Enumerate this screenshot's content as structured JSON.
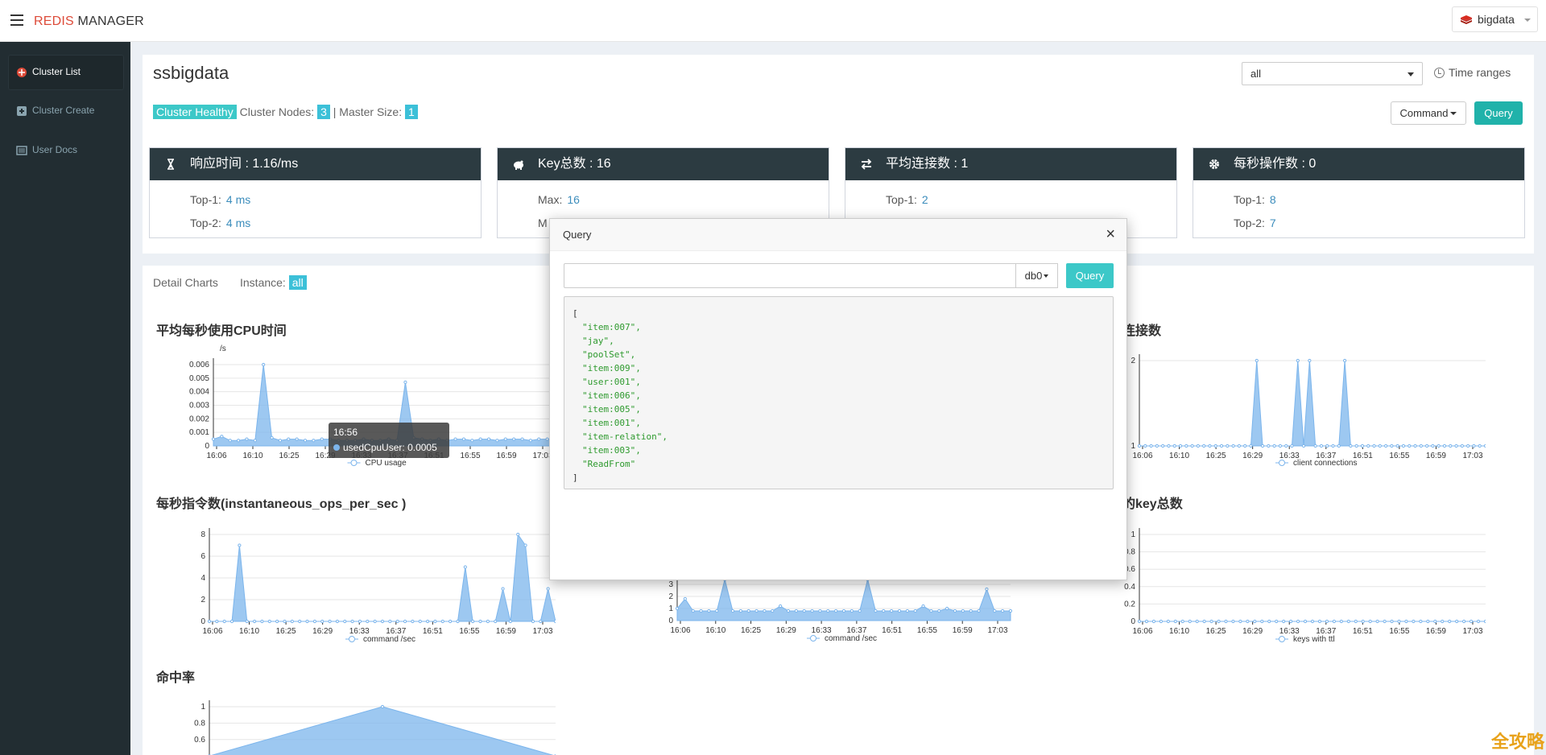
{
  "header": {
    "brand_red": "REDIS",
    "brand_dark": " MANAGER",
    "user": "bigdata"
  },
  "sidebar": {
    "items": [
      {
        "label": "Cluster List"
      },
      {
        "label": "Cluster Create"
      },
      {
        "label": "User Docs"
      }
    ]
  },
  "cluster": {
    "name": "ssbigdata",
    "healthy": "Cluster Healthy",
    "nodes_label": "Cluster Nodes:",
    "nodes": "3",
    "sep": "|",
    "master_label": "Master Size:",
    "master": "1",
    "select_value": "all",
    "time_ranges": "Time ranges",
    "command": "Command",
    "query": "Query"
  },
  "stats": [
    {
      "title": "响应时间 : 1.16/ms",
      "rows": [
        {
          "label": "Top-1:",
          "value": "4  ms"
        },
        {
          "label": "Top-2:",
          "value": "4  ms"
        }
      ]
    },
    {
      "title": "Key总数 : 16",
      "rows": [
        {
          "label": "Max:",
          "value": "16"
        },
        {
          "label": "M"
        }
      ]
    },
    {
      "title": "平均连接数 : 1",
      "rows": [
        {
          "label": "Top-1:",
          "value": "2"
        }
      ]
    },
    {
      "title": "每秒操作数 : 0",
      "rows": [
        {
          "label": "Top-1:",
          "value": "8"
        },
        {
          "label": "Top-2:",
          "value": "7"
        }
      ]
    }
  ],
  "detail": {
    "title": "Detail Charts",
    "instance_label": "Instance:",
    "instance": "all"
  },
  "chart_titles": {
    "cpu": "平均每秒使用CPU时间",
    "conn": "连接数",
    "ops": "每秒指令数(instantaneous_ops_per_sec )",
    "keys": "的key总数",
    "hit": "命中率"
  },
  "chart_data": [
    {
      "type": "area",
      "id": "cpu",
      "ylabel": "/s",
      "x": [
        "16:06",
        "16:10",
        "16:25",
        "16:29",
        "16:33",
        "16:37",
        "16:51",
        "16:55",
        "16:59",
        "17:03"
      ],
      "yticks": [
        0,
        0.001,
        0.002,
        0.003,
        0.004,
        0.005,
        0.006
      ],
      "ylim": [
        0,
        0.006
      ],
      "values": [
        0.0005,
        0.0007,
        0.0004,
        0.0004,
        0.0005,
        0.0004,
        0.006,
        0.0006,
        0.0004,
        0.0005,
        0.0005,
        0.0004,
        0.0004,
        0.0005,
        0.0005,
        0.0004,
        0.0004,
        0.0004,
        0.0005,
        0.0004,
        0.0004,
        0.0005,
        0.0004,
        0.0047,
        0.0006,
        0.0005,
        0.0004,
        0.0005,
        0.0004,
        0.0005,
        0.0005,
        0.0004,
        0.0005,
        0.0005,
        0.0004,
        0.0005,
        0.0005,
        0.0005,
        0.0004,
        0.0005,
        0.0005,
        0.0005
      ],
      "legend": "CPU usage",
      "tooltip": {
        "time": "16:56",
        "series": "usedCpuUser:",
        "value": "0.0005"
      }
    },
    {
      "type": "area",
      "id": "conn",
      "x": [
        "16:06",
        "16:10",
        "16:25",
        "16:29",
        "16:33",
        "16:37",
        "16:51",
        "16:55",
        "16:59",
        "17:03"
      ],
      "yticks": [
        1,
        2
      ],
      "ylim": [
        1,
        2
      ],
      "values": [
        1,
        1,
        1,
        1,
        1,
        1,
        1,
        1,
        1,
        1,
        1,
        1,
        1,
        1,
        1,
        1,
        1,
        1,
        1,
        1,
        2,
        1,
        1,
        1,
        1,
        1,
        1,
        2,
        1,
        2,
        1,
        1,
        1,
        1,
        1,
        2,
        1,
        1,
        1,
        1,
        1,
        1,
        1,
        1,
        1,
        1,
        1,
        1,
        1,
        1,
        1,
        1,
        1,
        1,
        1,
        1,
        1,
        1,
        1,
        1
      ],
      "legend": "client connections"
    },
    {
      "type": "area",
      "id": "ops",
      "x": [
        "16:06",
        "16:10",
        "16:25",
        "16:29",
        "16:33",
        "16:37",
        "16:51",
        "16:55",
        "16:59",
        "17:03"
      ],
      "yticks": [
        0,
        2,
        4,
        6,
        8
      ],
      "ylim": [
        0,
        8
      ],
      "values": [
        0,
        0,
        0,
        0,
        7,
        0,
        0,
        0,
        0,
        0,
        0,
        0,
        0,
        0,
        0,
        0,
        0,
        0,
        0,
        0,
        0,
        0,
        0,
        0,
        0,
        0,
        0,
        0,
        0,
        0,
        0,
        0,
        0,
        0,
        5,
        0,
        0,
        0,
        0,
        3,
        0,
        8,
        7,
        0,
        0,
        3,
        0
      ],
      "legend": "command  /sec"
    },
    {
      "type": "area",
      "id": "ops2",
      "x": [
        "16:06",
        "16:10",
        "16:25",
        "16:29",
        "16:33",
        "16:37",
        "16:51",
        "16:55",
        "16:59",
        "17:03"
      ],
      "yticks": [
        0,
        1,
        2,
        3
      ],
      "ylim": [
        0,
        3.4
      ],
      "values": [
        1,
        1.8,
        0.8,
        0.8,
        0.8,
        0.8,
        6,
        0.8,
        0.8,
        0.8,
        0.8,
        0.8,
        0.8,
        1.2,
        0.8,
        0.8,
        0.8,
        0.8,
        0.8,
        0.8,
        0.8,
        0.8,
        0.8,
        0.8,
        6,
        0.8,
        0.8,
        0.8,
        0.8,
        0.8,
        0.8,
        1.2,
        0.8,
        0.8,
        1,
        0.8,
        0.8,
        0.8,
        0.8,
        2.6,
        0.8,
        0.8,
        0.8
      ],
      "legend": "command  /sec"
    },
    {
      "type": "area",
      "id": "keys",
      "x": [
        "16:06",
        "16:10",
        "16:25",
        "16:29",
        "16:33",
        "16:37",
        "16:51",
        "16:55",
        "16:59",
        "17:03"
      ],
      "yticks": [
        0,
        0.2,
        0.4,
        0.6,
        0.8,
        1
      ],
      "ylim": [
        0,
        1
      ],
      "values": [
        0,
        0,
        0,
        0,
        0,
        0,
        0,
        0,
        0,
        0,
        0,
        0,
        0,
        0,
        0,
        0,
        0,
        0,
        0,
        0,
        0,
        0,
        0,
        0,
        0,
        0,
        0,
        0,
        0,
        0,
        0,
        0,
        0,
        0,
        0,
        0,
        0,
        0,
        0,
        0,
        0,
        0,
        0,
        0,
        0,
        0,
        0,
        0,
        0
      ],
      "legend": "keys with ttl"
    },
    {
      "type": "area",
      "id": "hit",
      "yticks": [
        0.6,
        0.8,
        1
      ],
      "ylim": [
        0,
        1
      ],
      "values": [
        0.4,
        1,
        0.4
      ]
    }
  ],
  "modal": {
    "title": "Query",
    "close": "×",
    "db": "db0",
    "query": "Query",
    "open": "[",
    "close_bracket": "]",
    "results": [
      "\"item:007\",",
      "\"jay\",",
      "\"poolSet\",",
      "\"item:009\",",
      "\"user:001\",",
      "\"item:006\",",
      "\"item:005\",",
      "\"item:001\",",
      "\"item-relation\",",
      "\"item:003\",",
      "\"ReadFrom\""
    ]
  },
  "watermark": "全攻略"
}
